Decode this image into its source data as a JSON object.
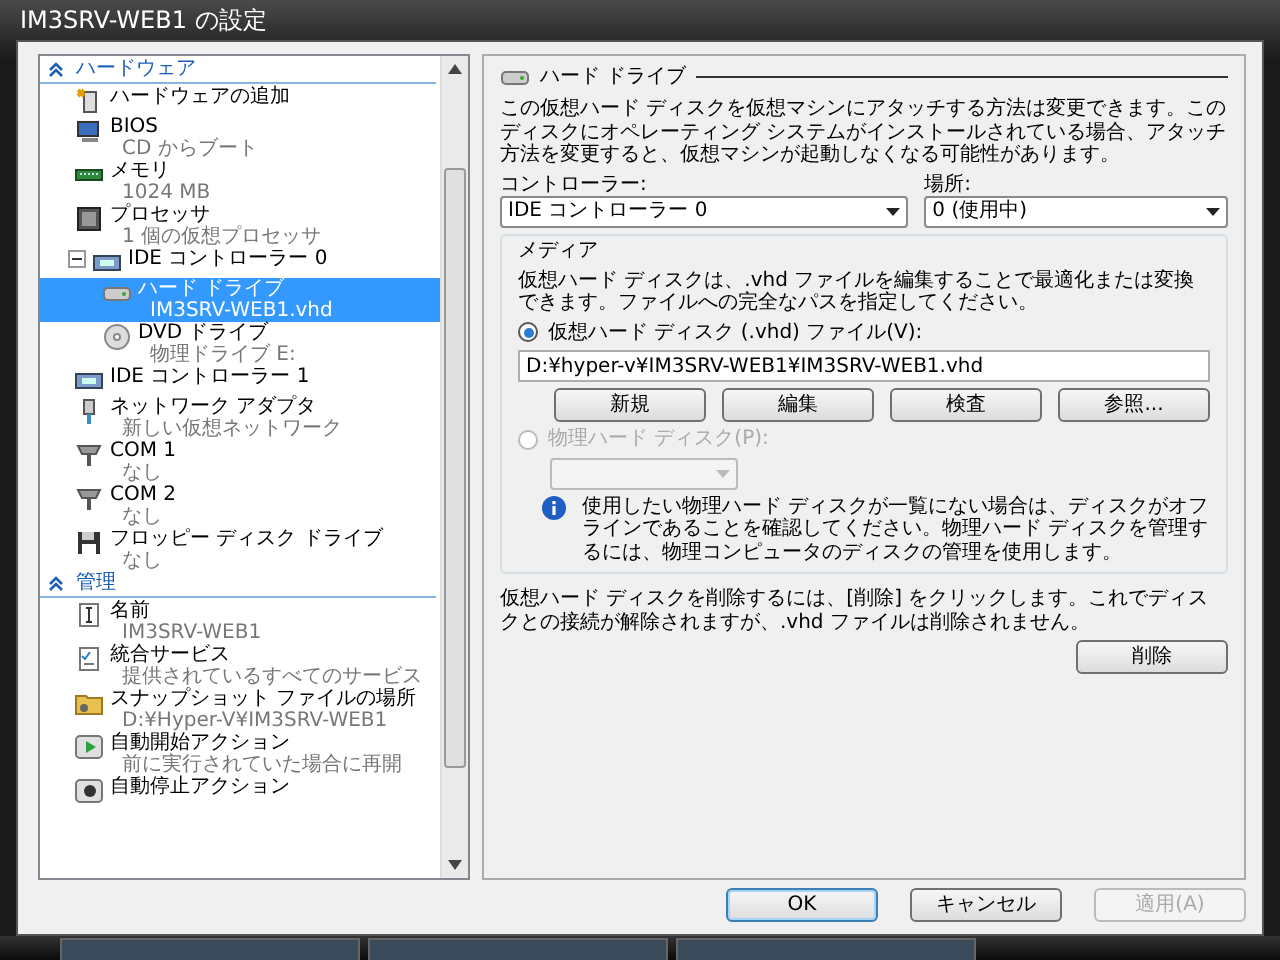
{
  "window": {
    "title": "IM3SRV-WEB1 の設定"
  },
  "sidebar": {
    "sections": [
      {
        "title": "ハードウェア",
        "expanded": true,
        "items": [
          {
            "kind": "add",
            "label": "ハードウェアの追加",
            "selected": false
          },
          {
            "kind": "bios",
            "label": "BIOS",
            "sub": "CD からブート",
            "selected": false
          },
          {
            "kind": "memory",
            "label": "メモリ",
            "sub": "1024 MB",
            "selected": false
          },
          {
            "kind": "cpu",
            "label": "プロセッサ",
            "sub": "1 個の仮想プロセッサ",
            "selected": false
          },
          {
            "kind": "controller",
            "label": "IDE コントローラー 0",
            "selected": false,
            "expanded": true,
            "children": [
              {
                "kind": "disk",
                "label": "ハード ドライブ",
                "sub": "IM3SRV-WEB1.vhd",
                "selected": true
              },
              {
                "kind": "dvd",
                "label": "DVD ドライブ",
                "sub": "物理ドライブ E:",
                "selected": false
              }
            ]
          },
          {
            "kind": "controller",
            "label": "IDE コントローラー 1",
            "selected": false
          },
          {
            "kind": "network",
            "label": "ネットワーク アダプタ",
            "sub": "新しい仮想ネットワーク",
            "selected": false
          },
          {
            "kind": "port",
            "label": "COM 1",
            "sub": "なし",
            "selected": false
          },
          {
            "kind": "port",
            "label": "COM 2",
            "sub": "なし",
            "selected": false
          },
          {
            "kind": "floppy",
            "label": "フロッピー ディスク ドライブ",
            "sub": "なし",
            "selected": false
          }
        ]
      },
      {
        "title": "管理",
        "expanded": true,
        "items": [
          {
            "kind": "name",
            "label": "名前",
            "sub": "IM3SRV-WEB1",
            "selected": false
          },
          {
            "kind": "services",
            "label": "統合サービス",
            "sub": "提供されているすべてのサービス",
            "selected": false
          },
          {
            "kind": "folder",
            "label": "スナップショット ファイルの場所",
            "sub": "D:¥Hyper-V¥IM3SRV-WEB1",
            "selected": false
          },
          {
            "kind": "start",
            "label": "自動開始アクション",
            "sub": "前に実行されていた場合に再開",
            "selected": false
          },
          {
            "kind": "stop",
            "label": "自動停止アクション",
            "selected": false
          }
        ]
      }
    ]
  },
  "panel": {
    "title": "ハード ドライブ",
    "description": "この仮想ハード ディスクを仮想マシンにアタッチする方法は変更できます。このディスクにオペレーティング システムがインストールされている場合、アタッチ方法を変更すると、仮想マシンが起動しなくなる可能性があります。",
    "controller": {
      "label": "コントローラー:",
      "value": "IDE コントローラー 0"
    },
    "location": {
      "label": "場所:",
      "value": "0 (使用中)"
    },
    "media": {
      "title": "メディア",
      "description": "仮想ハード ディスクは、.vhd ファイルを編集することで最適化または変換できます。ファイルへの完全なパスを指定してください。",
      "options": [
        {
          "label": "仮想ハード ディスク (.vhd) ファイル(V):",
          "selected": true,
          "disabled": false,
          "kind": "file",
          "value": "D:¥hyper-v¥IM3SRV-WEB1¥IM3SRV-WEB1.vhd",
          "buttons": [
            "新規",
            "編集",
            "検査",
            "参照..."
          ]
        },
        {
          "label": "物理ハード ディスク(P):",
          "selected": false,
          "disabled": true,
          "kind": "physical",
          "info": "使用したい物理ハード ディスクが一覧にない場合は、ディスクがオフラインであることを確認してください。物理ハード ディスクを管理するには、物理コンピュータのディスクの管理を使用します。"
        }
      ]
    },
    "remove_text": "仮想ハード ディスクを削除するには、[削除] をクリックします。これでディスクとの接続が解除されますが、.vhd ファイルは削除されません。",
    "remove_button": "削除"
  },
  "buttons": [
    {
      "label": "OK",
      "default": true,
      "disabled": false
    },
    {
      "label": "キャンセル",
      "default": false,
      "disabled": false
    },
    {
      "label": "適用(A)",
      "default": false,
      "disabled": true
    }
  ]
}
